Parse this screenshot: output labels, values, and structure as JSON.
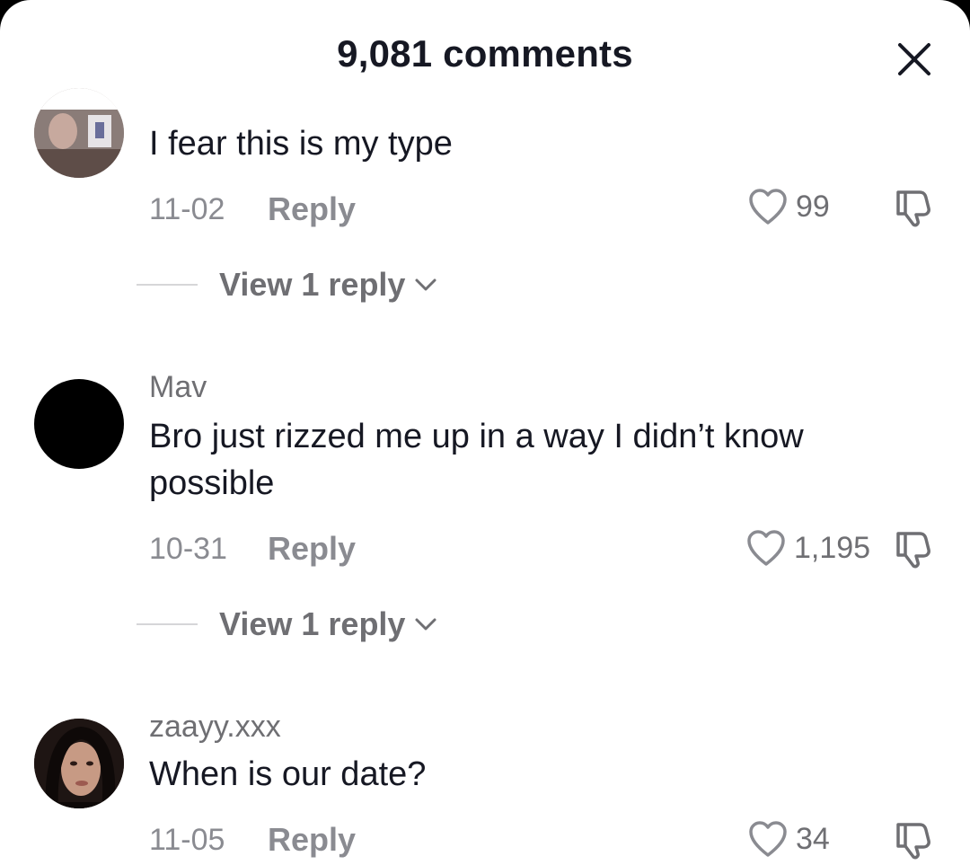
{
  "header": {
    "title": "9,081 comments"
  },
  "comments": [
    {
      "username": "",
      "text": "I fear this is my type",
      "date": "11-02",
      "reply_label": "Reply",
      "likes": "99",
      "view_replies": "View 1 reply"
    },
    {
      "username": "Mav",
      "text": "Bro just rizzed me up in a way I didn’t know possible",
      "date": "10-31",
      "reply_label": "Reply",
      "likes": "1,195",
      "view_replies": "View 1 reply"
    },
    {
      "username": "zaayy.xxx",
      "text": "When is our date?",
      "date": "11-05",
      "reply_label": "Reply",
      "likes": "34"
    }
  ],
  "icons": {
    "close": "close-icon",
    "like": "heart-outline-icon",
    "dislike": "thumbs-down-icon",
    "expand": "chevron-down-icon"
  }
}
